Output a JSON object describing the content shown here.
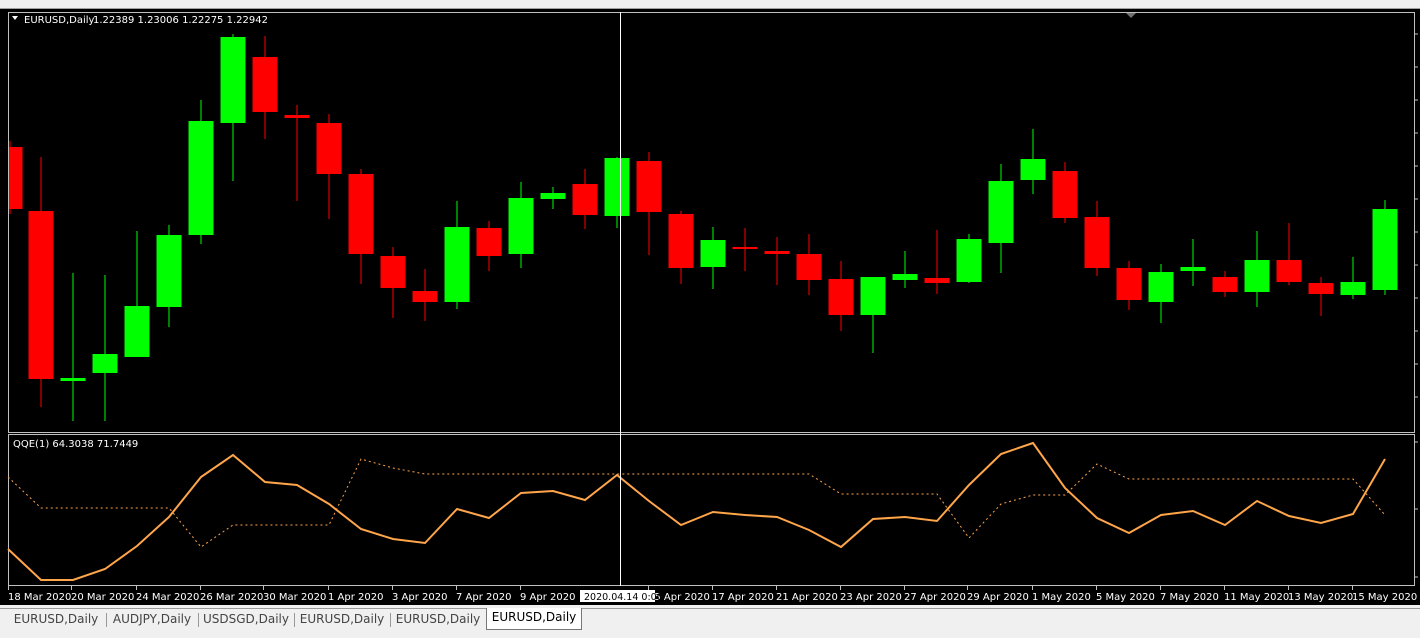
{
  "main_chart": {
    "header": {
      "symbol": "EURUSD,Daily",
      "ohlc": "1.22389 1.23006 1.22275 1.22942"
    },
    "colors": {
      "bull": "#00ff00",
      "bear": "#ff0000",
      "background": "#000000",
      "crosshair": "#ffffff"
    }
  },
  "indicator": {
    "header": "QQE(1) 64.3038 71.7449",
    "colors": {
      "line": "#ffa54a",
      "dotted": "#ffa54a"
    }
  },
  "crosshair_label": "2020.04.14 0:00",
  "time_axis": {
    "labels": [
      "18 Mar 2020",
      "20 Mar 2020",
      "24 Mar 2020",
      "26 Mar 2020",
      "30 Mar 2020",
      "1 Apr 2020",
      "3 Apr 2020",
      "7 Apr 2020",
      "9 Apr 2020",
      "15 Apr 2020",
      "17 Apr 2020",
      "21 Apr 2020",
      "23 Apr 2020",
      "27 Apr 2020",
      "29 Apr 2020",
      "1 May 2020",
      "5 May 2020",
      "7 May 2020",
      "11 May 2020",
      "13 May 2020",
      "15 May 2020"
    ]
  },
  "tabs": [
    {
      "label": "EURUSD,Daily",
      "active": false
    },
    {
      "label": "AUDJPY,Daily",
      "active": false
    },
    {
      "label": "USDSGD,Daily",
      "active": false
    },
    {
      "label": "EURUSD,Daily",
      "active": false
    },
    {
      "label": "EURUSD,Daily",
      "active": false
    },
    {
      "label": "EURUSD,Daily",
      "active": true
    }
  ]
}
